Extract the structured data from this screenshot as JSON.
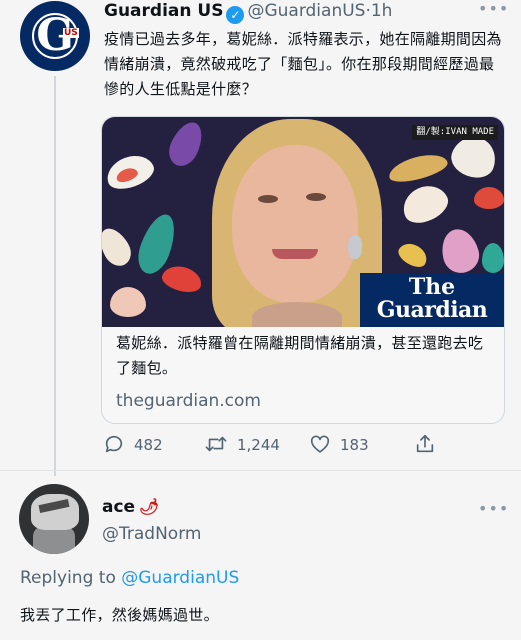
{
  "tweet": {
    "author_name": "Guardian US",
    "handle": "@GuardianUS",
    "separator": "·",
    "time": "1h",
    "more_label": "•••",
    "text": "疫情已過去多年，葛妮絲．派特羅表示，她在隔離期間因為情緒崩潰，竟然破戒吃了「麵包」。你在那段期間經歷過最慘的人生低點是什麼？",
    "card": {
      "credit": "翻/製:IVAN MADE",
      "logo_line1": "The",
      "logo_line2": "Guardian",
      "title": "葛妮絲．派特羅曾在隔離期間情緒崩潰，甚至還跑去吃了麵包。",
      "domain": "theguardian.com"
    },
    "actions": {
      "replies": "482",
      "retweets": "1,244",
      "likes": "183"
    }
  },
  "reply": {
    "author_name": "ace",
    "handle": "@TradNorm",
    "more_label": "•••",
    "replying_prefix": "Replying to",
    "replying_to": "@GuardianUS",
    "text": "我丟了工作，然後媽媽過世。"
  },
  "avatar_glyph": "G",
  "avatar_badge": "US",
  "colors": {
    "guardian_blue": "#052962",
    "twitter_blue": "#1d9bf0",
    "muted_text": "#536471"
  }
}
